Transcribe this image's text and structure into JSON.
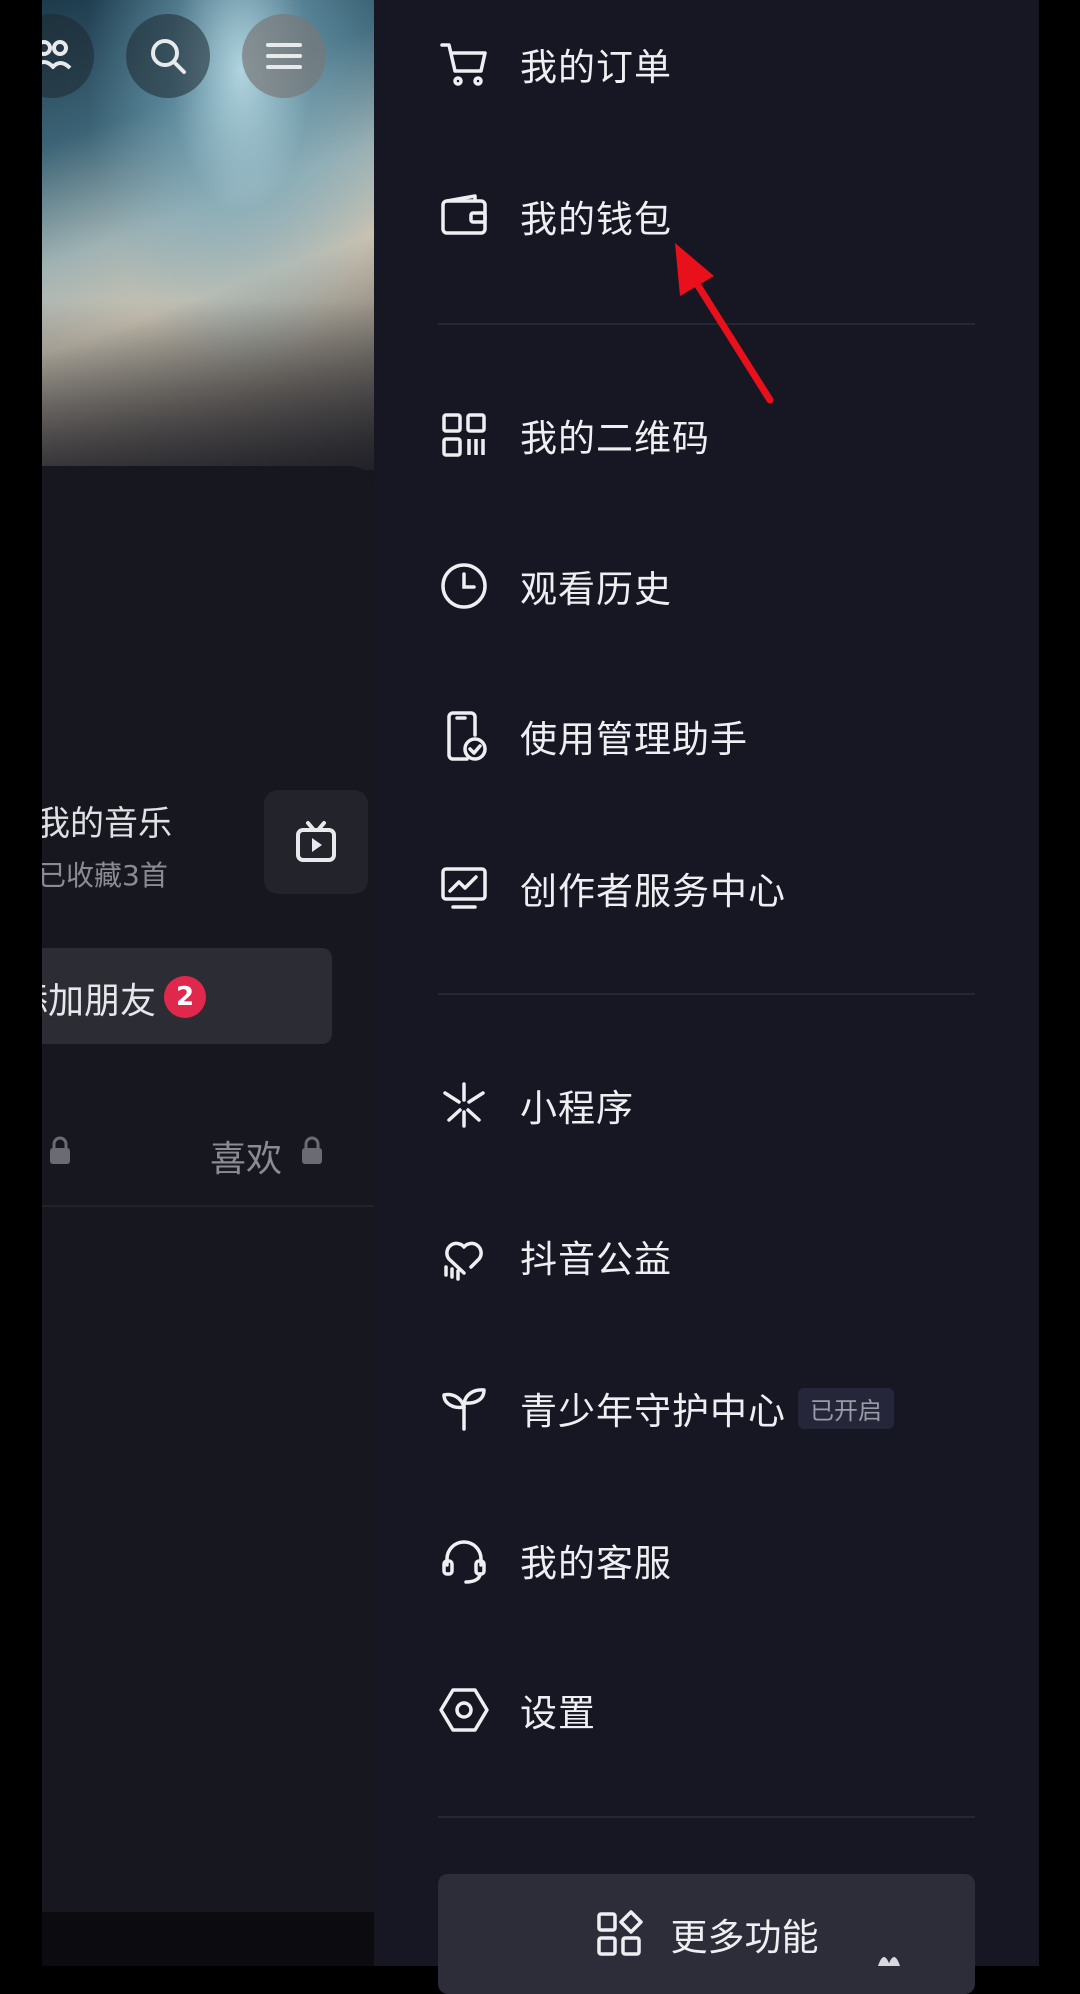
{
  "background_page": {
    "music_title": "我的音乐",
    "music_subtitle": "已收藏3首",
    "add_friend_label": "添加朋友",
    "add_friend_badge": "2",
    "tab_like_label": "喜欢"
  },
  "drawer": {
    "group1": [
      {
        "label": "我的订单",
        "icon": "shopping-cart-icon"
      },
      {
        "label": "我的钱包",
        "icon": "wallet-icon"
      }
    ],
    "group2": [
      {
        "label": "我的二维码",
        "icon": "qr-code-icon"
      },
      {
        "label": "观看历史",
        "icon": "clock-icon"
      },
      {
        "label": "使用管理助手",
        "icon": "phone-check-icon"
      },
      {
        "label": "创作者服务中心",
        "icon": "monitor-chart-icon"
      }
    ],
    "group3": [
      {
        "label": "小程序",
        "icon": "mini-program-icon"
      },
      {
        "label": "抖音公益",
        "icon": "heart-hand-icon"
      },
      {
        "label": "青少年守护中心",
        "icon": "sprout-icon",
        "status": "已开启"
      },
      {
        "label": "我的客服",
        "icon": "headset-icon"
      },
      {
        "label": "设置",
        "icon": "settings-hexagon-icon"
      }
    ],
    "more_button": {
      "label": "更多功能",
      "icon": "grid-apps-icon"
    }
  },
  "annotation": {
    "color": "#e8101a",
    "target": "我的钱包"
  }
}
